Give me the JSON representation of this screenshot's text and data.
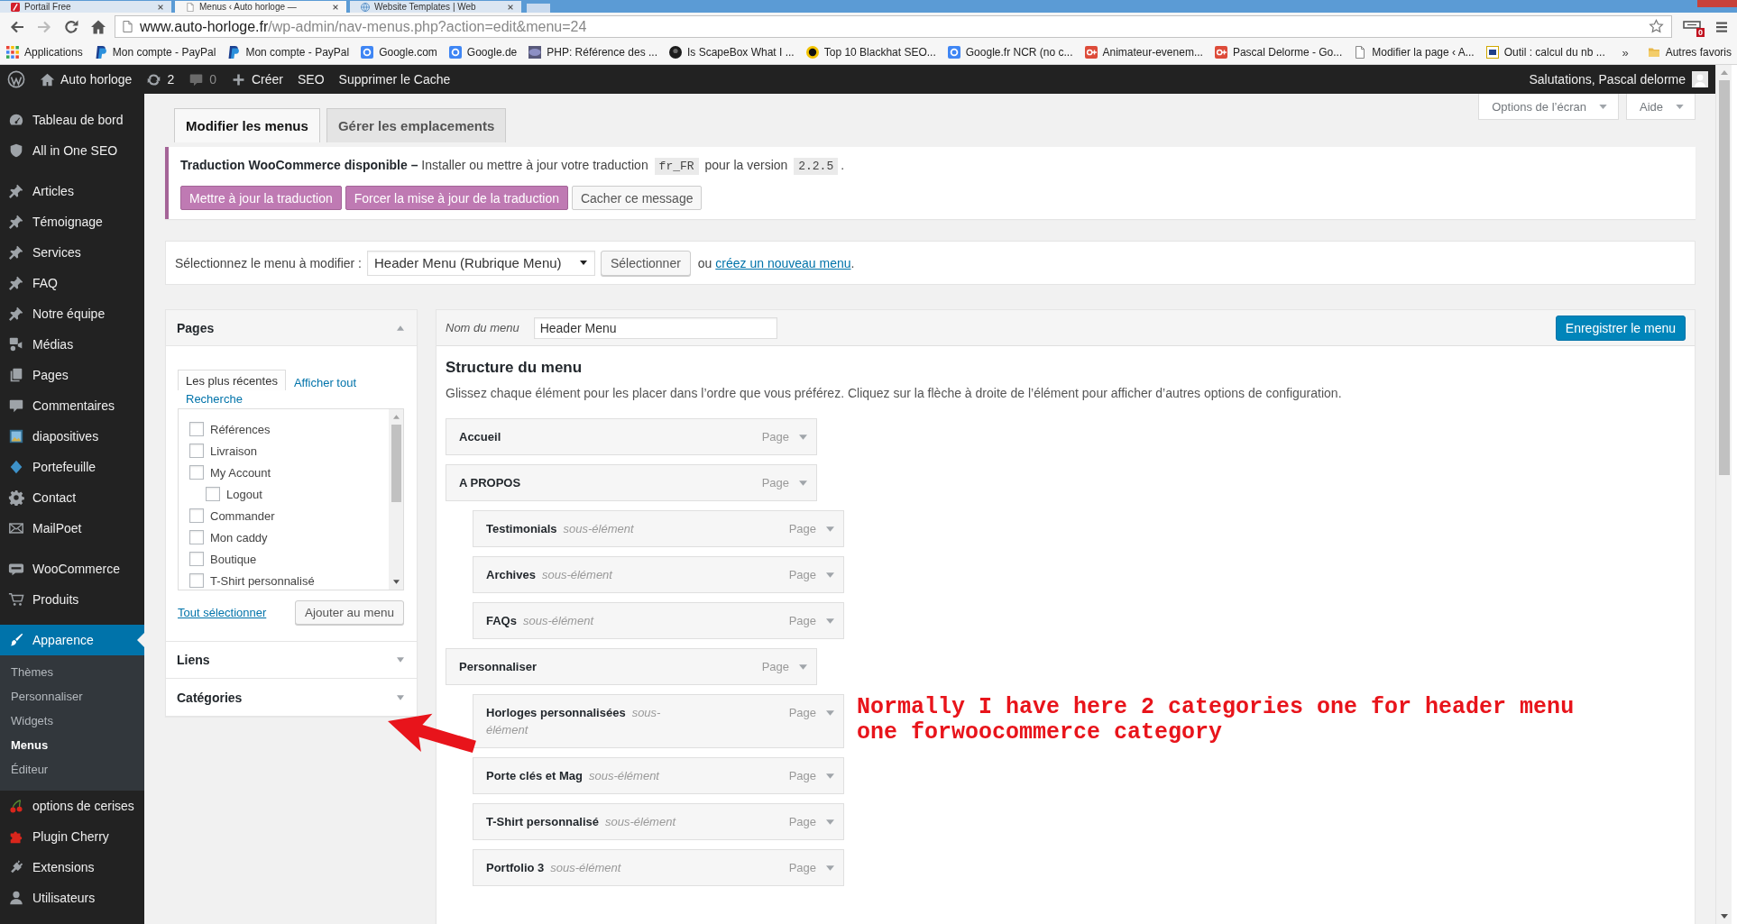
{
  "browser": {
    "tabs": [
      {
        "title": "Portail Free",
        "kind": "free",
        "selected": false
      },
      {
        "title": "Menus ‹ Auto horloge —",
        "kind": "page",
        "selected": true
      },
      {
        "title": "Website Templates | Web",
        "kind": "globe",
        "selected": false
      }
    ],
    "address": {
      "host": "www.auto-horloge.fr",
      "path": "/wp-admin/nav-menus.php?action=edit&menu=24"
    },
    "extension_badge": "0",
    "bookmarks": [
      {
        "label": "Applications",
        "kind": "apps"
      },
      {
        "label": "Mon compte - PayPal",
        "kind": "paypal"
      },
      {
        "label": "Mon compte - PayPal",
        "kind": "paypal"
      },
      {
        "label": "Google.com",
        "kind": "google"
      },
      {
        "label": "Google.de",
        "kind": "google"
      },
      {
        "label": "PHP: Référence des ...",
        "kind": "php"
      },
      {
        "label": "Is ScapeBox What I ...",
        "kind": "dark"
      },
      {
        "label": "Top 10 Blackhat SEO...",
        "kind": "bw"
      },
      {
        "label": "Google.fr NCR (no c...",
        "kind": "google"
      },
      {
        "label": "Animateur-evenem...",
        "kind": "gplus"
      },
      {
        "label": "Pascal Delorme - Go...",
        "kind": "gplus"
      },
      {
        "label": "Modifier la page ‹ A...",
        "kind": "doc"
      },
      {
        "label": "Outil : calcul du nb ...",
        "kind": "w"
      }
    ],
    "overflow": "»",
    "other_bookmarks": "Autres favoris"
  },
  "admin_bar": {
    "items": [
      {
        "kind": "logo",
        "dimmed": false
      },
      {
        "kind": "home",
        "label": "Auto horloge",
        "dimmed": false
      },
      {
        "kind": "updates",
        "label": "2",
        "dimmed": false
      },
      {
        "kind": "comments",
        "label": "0",
        "dimmed": true
      },
      {
        "kind": "new",
        "label": "Créer",
        "dimmed": false
      },
      {
        "kind": "text",
        "label": "SEO",
        "dimmed": false
      },
      {
        "kind": "text",
        "label": "Supprimer le Cache",
        "dimmed": false
      }
    ],
    "greeting": "Salutations, Pascal delorme"
  },
  "sidebar": {
    "sections": [
      {
        "items": [
          {
            "label": "Tableau de bord",
            "kind": "dashboard",
            "selected": false
          },
          {
            "label": "All in One SEO",
            "kind": "shield",
            "selected": false
          }
        ]
      },
      {
        "items": [
          {
            "label": "Articles",
            "kind": "pin",
            "selected": false
          },
          {
            "label": "Témoignage",
            "kind": "pin",
            "selected": false
          },
          {
            "label": "Services",
            "kind": "pin",
            "selected": false
          },
          {
            "label": "FAQ",
            "kind": "pin",
            "selected": false
          },
          {
            "label": "Notre équipe",
            "kind": "pin",
            "selected": false
          },
          {
            "label": "Médias",
            "kind": "media",
            "selected": false
          },
          {
            "label": "Pages",
            "kind": "pages",
            "selected": false
          },
          {
            "label": "Commentaires",
            "kind": "comment",
            "selected": false
          },
          {
            "label": "diapositives",
            "kind": "slides",
            "selected": false
          },
          {
            "label": "Portefeuille",
            "kind": "diamond",
            "selected": false
          },
          {
            "label": "Contact",
            "kind": "gear",
            "selected": false
          },
          {
            "label": "MailPoet",
            "kind": "mail",
            "selected": false
          }
        ]
      },
      {
        "items": [
          {
            "label": "WooCommerce",
            "kind": "woo",
            "selected": false
          },
          {
            "label": "Produits",
            "kind": "cart",
            "selected": false
          }
        ]
      },
      {
        "items": [
          {
            "label": "Apparence",
            "kind": "brush",
            "selected": true,
            "children": [
              {
                "label": "Thèmes",
                "selected": false
              },
              {
                "label": "Personnaliser",
                "selected": false
              },
              {
                "label": "Widgets",
                "selected": false
              },
              {
                "label": "Menus",
                "selected": true
              },
              {
                "label": "Éditeur",
                "selected": false
              }
            ]
          },
          {
            "label": "options de cerises",
            "kind": "cherry",
            "selected": false
          },
          {
            "label": "Plugin Cherry",
            "kind": "puzzle",
            "selected": false
          },
          {
            "label": "Extensions",
            "kind": "plug",
            "selected": false
          },
          {
            "label": "Utilisateurs",
            "kind": "user",
            "selected": false
          }
        ]
      }
    ]
  },
  "page": {
    "tabs": [
      {
        "label": "Modifier les menus",
        "selected": true
      },
      {
        "label": "Gérer les emplacements",
        "selected": false
      }
    ],
    "screen_buttons": [
      "Options de l’écran",
      "Aide"
    ],
    "notice": {
      "segments": [
        {
          "kind": "strong",
          "text": "Traduction WooCommerce disponible –"
        },
        {
          "kind": "plain",
          "text": " Installer ou mettre à jour votre traduction "
        },
        {
          "kind": "code",
          "text": "fr_FR"
        },
        {
          "kind": "plain",
          "text": " pour la version "
        },
        {
          "kind": "code",
          "text": "2.2.5"
        },
        {
          "kind": "plain",
          "text": "."
        }
      ],
      "buttons": [
        {
          "label": "Mettre à jour la traduction",
          "kind": "primary"
        },
        {
          "label": "Forcer la mise à jour de la traduction",
          "kind": "primary"
        },
        {
          "label": "Cacher ce message",
          "kind": "secondary"
        }
      ]
    },
    "menu_select": {
      "label": "Sélectionnez le menu à modifier :",
      "value": "Header Menu (Rubrique Menu)",
      "button": "Sélectionner",
      "or_text": "ou",
      "link": "créez un nouveau menu",
      "end": "."
    },
    "add_panels": [
      {
        "title": "Pages",
        "expanded": true,
        "tabs": [
          {
            "label": "Les plus récentes",
            "selected": true
          },
          {
            "label": "Afficher tout",
            "selected": false
          },
          {
            "label": "Recherche",
            "selected": false
          }
        ],
        "items": [
          {
            "title": "Références",
            "checked": false
          },
          {
            "title": "Livraison",
            "checked": false
          },
          {
            "title": "My Account",
            "checked": false,
            "children": [
              {
                "title": "Logout",
                "checked": false
              }
            ]
          },
          {
            "title": "Commander",
            "checked": false
          },
          {
            "title": "Mon caddy",
            "checked": false
          },
          {
            "title": "Boutique",
            "checked": false
          },
          {
            "title": "T-Shirt personnalisé",
            "checked": false
          }
        ],
        "select_all": "Tout sélectionner",
        "add_button": "Ajouter au menu"
      },
      {
        "title": "Liens",
        "expanded": false
      },
      {
        "title": "Catégories",
        "expanded": false
      }
    ],
    "menu_editor": {
      "name_label": "Nom du menu",
      "name_value": "Header Menu",
      "save_button": "Enregistrer le menu",
      "heading": "Structure du menu",
      "description": "Glissez chaque élément pour les placer dans l’ordre que vous préférez. Cliquez sur la flèche à droite de l’élément pour afficher d’autres options de configuration.",
      "items": [
        {
          "title": "Accueil",
          "type": "Page"
        },
        {
          "title": "A PROPOS",
          "type": "Page",
          "children": [
            {
              "title": "Testimonials",
              "sub_label": "sous-élément",
              "type": "Page"
            },
            {
              "title": "Archives",
              "sub_label": "sous-élément",
              "type": "Page"
            },
            {
              "title": "FAQs",
              "sub_label": "sous-élément",
              "type": "Page"
            }
          ]
        },
        {
          "title": "Personnaliser",
          "type": "Page",
          "children": [
            {
              "title": "Horloges personnalisées",
              "sub_label": "sous-élément",
              "type": "Page"
            },
            {
              "title": "Porte clés et Mag",
              "sub_label": "sous-élément",
              "type": "Page"
            },
            {
              "title": "T-Shirt personnalisé",
              "sub_label": "sous-élément",
              "type": "Page"
            },
            {
              "title": "Portfolio 3",
              "sub_label": "sous-élément",
              "type": "Page"
            }
          ]
        }
      ]
    }
  },
  "annotation": {
    "lines": [
      "Normally I have here 2 categories one for header menu",
      "one forwoocommerce category"
    ]
  }
}
